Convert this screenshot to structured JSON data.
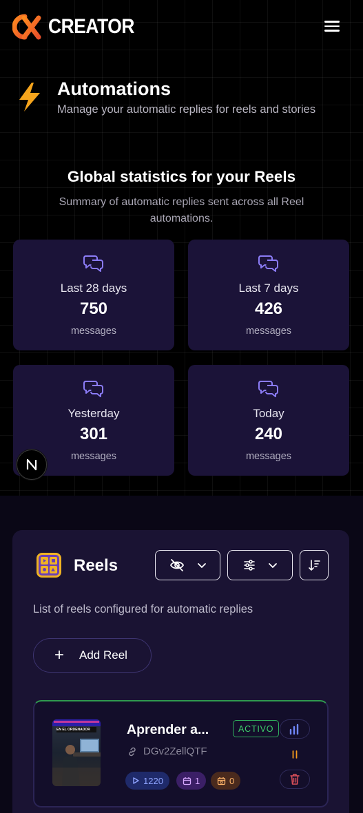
{
  "brand": {
    "name": "CREATOR"
  },
  "header": {
    "menu_icon": "hamburger-icon"
  },
  "page": {
    "title": "Automations",
    "subtitle": "Manage your automatic replies for reels and stories",
    "icon": "bolt-icon"
  },
  "stats": {
    "title": "Global statistics for your Reels",
    "subtitle": "Summary of automatic replies sent across all Reel automations.",
    "cards": [
      {
        "label": "Last 28 days",
        "value": "750",
        "unit": "messages"
      },
      {
        "label": "Last 7 days",
        "value": "426",
        "unit": "messages"
      },
      {
        "label": "Yesterday",
        "value": "301",
        "unit": "messages"
      },
      {
        "label": "Today",
        "value": "240",
        "unit": "messages"
      }
    ]
  },
  "badge": {
    "letter": "N"
  },
  "reels": {
    "title": "Reels",
    "description": "List of reels configured for automatic replies",
    "add_label": "Add Reel",
    "items": [
      {
        "name": "Aprender a...",
        "code": "DGv2ZellQTF",
        "status": "ACTIVO",
        "thumb_caption": "EN EL ORDENADOR",
        "views": "1220",
        "scheduled": "1",
        "stories": "0"
      }
    ]
  },
  "colors": {
    "accent": "#8b7cf6",
    "card": "#1b1338",
    "active": "#3ed06b",
    "orange": "#f59a1b",
    "danger": "#e0515b"
  }
}
